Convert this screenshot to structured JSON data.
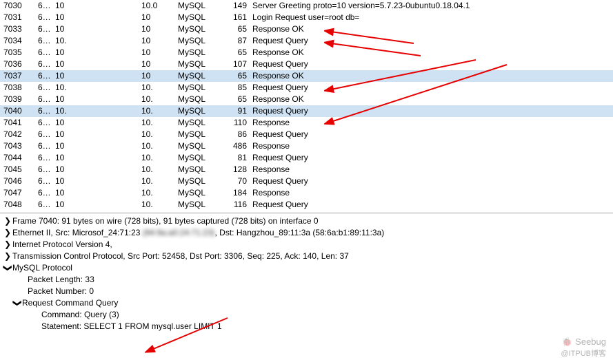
{
  "packets": [
    {
      "num": "7030",
      "time": "6…",
      "src": "10",
      "dst": "",
      "extra": "10.0",
      "proto": "MySQL",
      "len": "149",
      "info": "Server Greeting proto=10 version=5.7.23-0ubuntu0.18.04.1",
      "selected": false
    },
    {
      "num": "7031",
      "time": "6…",
      "src": "10",
      "dst": "",
      "extra": "10",
      "proto": "MySQL",
      "len": "161",
      "info": "Login Request user=root db=",
      "selected": false
    },
    {
      "num": "7033",
      "time": "6…",
      "src": "10",
      "dst": "",
      "extra": "10",
      "proto": "MySQL",
      "len": "65",
      "info": "Response OK",
      "selected": false
    },
    {
      "num": "7034",
      "time": "6…",
      "src": "10.",
      "dst": "",
      "extra": "10",
      "proto": "MySQL",
      "len": "87",
      "info": "Request Query",
      "selected": false
    },
    {
      "num": "7035",
      "time": "6…",
      "src": "10",
      "dst": "",
      "extra": "10",
      "proto": "MySQL",
      "len": "65",
      "info": "Response OK",
      "selected": false
    },
    {
      "num": "7036",
      "time": "6…",
      "src": "10",
      "dst": "",
      "extra": "10",
      "proto": "MySQL",
      "len": "107",
      "info": "Request Query",
      "selected": false
    },
    {
      "num": "7037",
      "time": "6…",
      "src": "10",
      "dst": "",
      "extra": "10",
      "proto": "MySQL",
      "len": "65",
      "info": "Response OK",
      "selected": true
    },
    {
      "num": "7038",
      "time": "6…",
      "src": "10.",
      "dst": "",
      "extra": "10.",
      "proto": "MySQL",
      "len": "85",
      "info": "Request Query",
      "selected": false
    },
    {
      "num": "7039",
      "time": "6…",
      "src": "10",
      "dst": "",
      "extra": "10.",
      "proto": "MySQL",
      "len": "65",
      "info": "Response OK",
      "selected": false
    },
    {
      "num": "7040",
      "time": "6…",
      "src": "10.",
      "dst": "",
      "extra": "10.",
      "proto": "MySQL",
      "len": "91",
      "info": "Request Query",
      "selected": true
    },
    {
      "num": "7041",
      "time": "6…",
      "src": "10",
      "dst": "",
      "extra": "10.",
      "proto": "MySQL",
      "len": "110",
      "info": "Response",
      "selected": false
    },
    {
      "num": "7042",
      "time": "6…",
      "src": "10",
      "dst": "",
      "extra": "10.",
      "proto": "MySQL",
      "len": "86",
      "info": "Request Query",
      "selected": false
    },
    {
      "num": "7043",
      "time": "6…",
      "src": "10",
      "dst": "",
      "extra": "10.",
      "proto": "MySQL",
      "len": "486",
      "info": "Response",
      "selected": false
    },
    {
      "num": "7044",
      "time": "6…",
      "src": "10",
      "dst": "",
      "extra": "10.",
      "proto": "MySQL",
      "len": "81",
      "info": "Request Query",
      "selected": false
    },
    {
      "num": "7045",
      "time": "6…",
      "src": "10",
      "dst": "",
      "extra": "10.",
      "proto": "MySQL",
      "len": "128",
      "info": "Response",
      "selected": false
    },
    {
      "num": "7046",
      "time": "6…",
      "src": "10",
      "dst": "",
      "extra": "10.",
      "proto": "MySQL",
      "len": "70",
      "info": "Request Query",
      "selected": false
    },
    {
      "num": "7047",
      "time": "6…",
      "src": "10",
      "dst": "",
      "extra": "10.",
      "proto": "MySQL",
      "len": "184",
      "info": "Response",
      "selected": false
    },
    {
      "num": "7048",
      "time": "6…",
      "src": "10",
      "dst": "",
      "extra": "10.",
      "proto": "MySQL",
      "len": "116",
      "info": "Request Query",
      "selected": false
    }
  ],
  "tree": {
    "frame": "Frame 7040: 91 bytes on wire (728 bits), 91 bytes captured (728 bits) on interface 0",
    "eth_prefix": "Ethernet II, Src: Microsof_24:71:23 ",
    "eth_blur": "(94:9a:a0:24:71:23)",
    "eth_suffix": ", Dst: Hangzhou_89:11:3a (58:6a:b1:89:11:3a)",
    "ip": "Internet Protocol Version 4,",
    "tcp": "Transmission Control Protocol, Src Port: 52458, Dst Port: 3306, Seq: 225, Ack: 140, Len: 37",
    "mysql": "MySQL Protocol",
    "packet_length": "Packet Length: 33",
    "packet_number": "Packet Number: 0",
    "command_query": "Request Command Query",
    "command": "Command: Query (3)",
    "statement": "Statement: SELECT 1 FROM mysql.user LIMIT 1"
  },
  "watermark": {
    "name": "Seebug",
    "sub": "@ITPUB博客"
  },
  "arrows": {
    "collapsed": "❯",
    "expanded": "❯"
  }
}
